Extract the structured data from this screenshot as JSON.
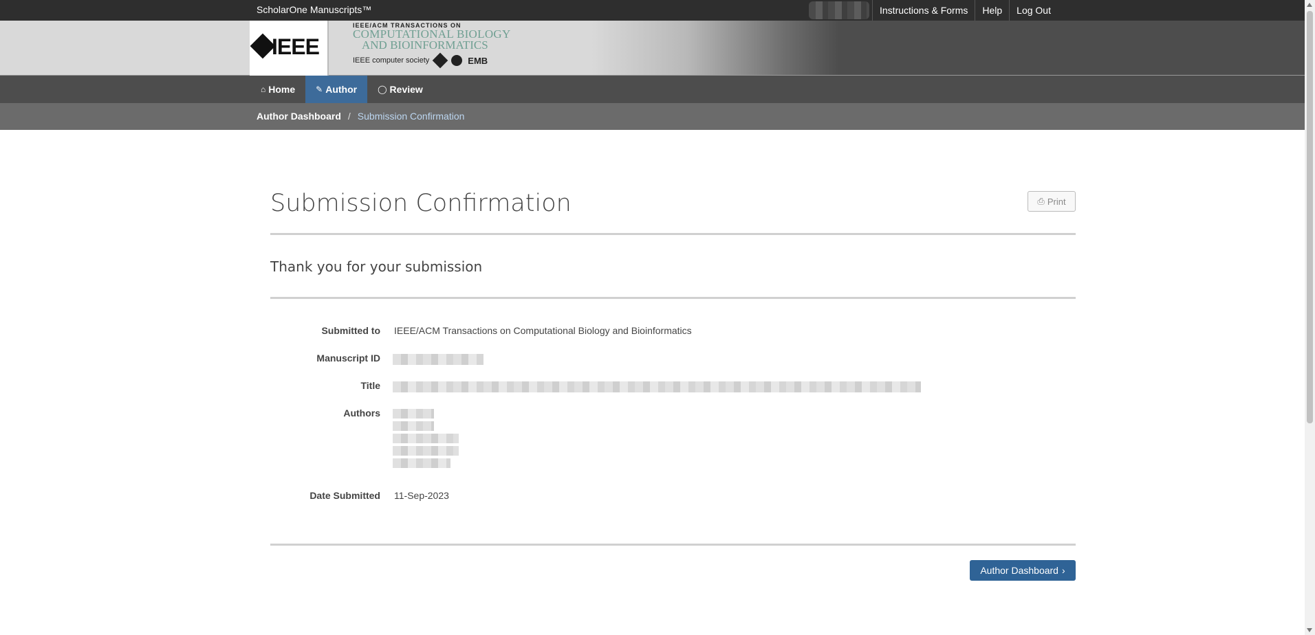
{
  "topbar": {
    "brand": "ScholarOne Manuscripts™",
    "links": [
      "Instructions & Forms",
      "Help",
      "Log Out"
    ]
  },
  "banner": {
    "ieee_logo": "IEEE",
    "journal_line1": "IEEE/ACM TRANSACTIONS ON",
    "journal_line2": "COMPUTATIONAL BIOLOGY",
    "journal_line3": "AND BIOINFORMATICS",
    "societies_text": "IEEE computer society",
    "emb": "EMB"
  },
  "nav": {
    "tabs": [
      {
        "label": "Home",
        "icon": "home-icon"
      },
      {
        "label": "Author",
        "icon": "pencil-icon"
      },
      {
        "label": "Review",
        "icon": "comment-icon"
      }
    ]
  },
  "breadcrumb": {
    "root": "Author Dashboard",
    "separator": "/",
    "current": "Submission Confirmation"
  },
  "main": {
    "title": "Submission Confirmation",
    "print_label": "Print",
    "subtitle": "Thank you for your submission",
    "fields": {
      "submitted_to_label": "Submitted to",
      "submitted_to_value": "IEEE/ACM Transactions on Computational Biology and Bioinformatics",
      "manuscript_id_label": "Manuscript ID",
      "title_label": "Title",
      "authors_label": "Authors",
      "date_label": "Date Submitted",
      "date_value": "11-Sep-2023"
    },
    "dashboard_button": "Author Dashboard"
  },
  "colors": {
    "topbar": "#2e2e2e",
    "nav": "#4d4d4d",
    "active_tab": "#3d6b9a",
    "breadcrumb_bar": "#6b6b6b",
    "primary_button": "#2f6396"
  }
}
